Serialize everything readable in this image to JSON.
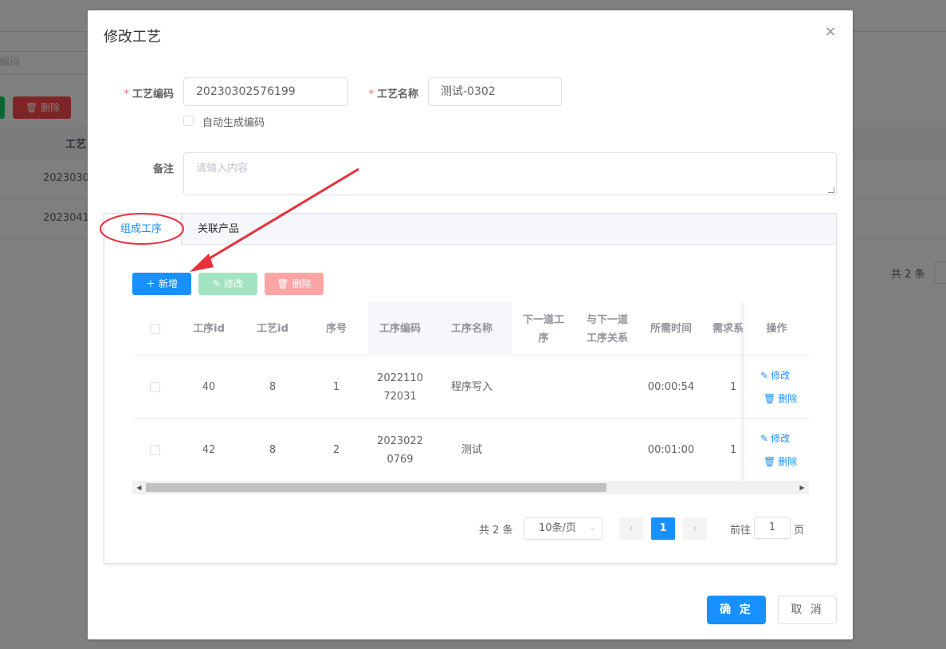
{
  "background": {
    "search_placeholder": "编码",
    "delete_label": "删除",
    "column_header": "工艺",
    "rows": [
      "2023030",
      "2023041"
    ],
    "total": "共 2 条"
  },
  "dialog": {
    "title": "修改工艺",
    "close_icon": "close-icon",
    "code_label": "工艺编码",
    "code_value": "20230302576199",
    "name_label": "工艺名称",
    "name_value": "测试-0302",
    "auto_code_label": "自动生成编码",
    "remark_label": "备注",
    "remark_placeholder": "请输入内容",
    "tabs": [
      "组成工序",
      "关联产品"
    ],
    "toolbar": {
      "add": "新增",
      "edit": "修改",
      "delete": "删除"
    },
    "table": {
      "headers": [
        "工序id",
        "工艺id",
        "序号",
        "工序编码",
        "工序名称",
        "下一道工序",
        "与下一道工序关系",
        "所需时间",
        "需求系",
        "操作"
      ],
      "rows": [
        {
          "process_id": "40",
          "craft_id": "8",
          "seq": "1",
          "code": "2022110 72031",
          "code_line1": "2022110",
          "code_line2": "72031",
          "name": "程序写入",
          "next": "",
          "relation": "",
          "time": "00:00:54",
          "demand": "1"
        },
        {
          "process_id": "42",
          "craft_id": "8",
          "seq": "2",
          "code": "2023022 0769",
          "code_line1": "2023022",
          "code_line2": "0769",
          "name": "测试",
          "next": "",
          "relation": "",
          "time": "00:01:00",
          "demand": "1"
        }
      ],
      "op_edit": "修改",
      "op_delete": "删除"
    },
    "pagination": {
      "total": "共 2 条",
      "page_size": "10条/页",
      "current_page": "1",
      "goto_label": "前往",
      "goto_value": "1",
      "page_suffix": "页"
    },
    "footer": {
      "ok": "确 定",
      "cancel": "取 消"
    }
  },
  "colors": {
    "primary": "#1890ff",
    "danger": "#f56c6c",
    "annotation": "#e8303a"
  }
}
